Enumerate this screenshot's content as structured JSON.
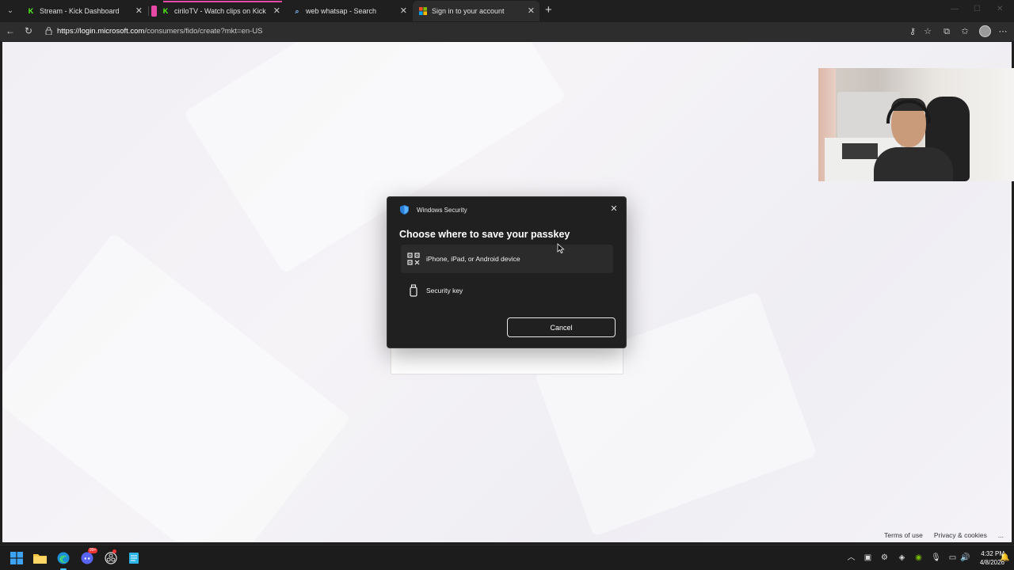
{
  "browser": {
    "tabs": [
      {
        "label": "Stream - Kick Dashboard",
        "icon": "kick-icon",
        "active": false
      },
      {
        "label": "ciriloTV - Watch clips on Kick",
        "icon": "kick-icon",
        "active": false
      },
      {
        "label": "web whatsap - Search",
        "icon": "search-icon",
        "active": false
      },
      {
        "label": "Sign in to your account",
        "icon": "microsoft-icon",
        "active": true
      }
    ],
    "url_host": "https://login.microsoft.com",
    "url_path": "/consumers/fido/create?mkt=en-US"
  },
  "page": {
    "footer": {
      "terms": "Terms of use",
      "privacy": "Privacy & cookies",
      "more": "..."
    }
  },
  "dialog": {
    "app_title": "Windows Security",
    "heading": "Choose where to save your passkey",
    "options": [
      {
        "label": "iPhone, iPad, or Android device",
        "icon": "qr-code-icon"
      },
      {
        "label": "Security key",
        "icon": "usb-key-icon"
      }
    ],
    "cancel_label": "Cancel"
  },
  "taskbar": {
    "time": "4:32 PM",
    "date": "4/8/2026",
    "discord_badge": "99+"
  },
  "colors": {
    "kick_green": "#53fc18",
    "dialog_bg": "#202020",
    "accent_blue": "#4cc2ff"
  }
}
